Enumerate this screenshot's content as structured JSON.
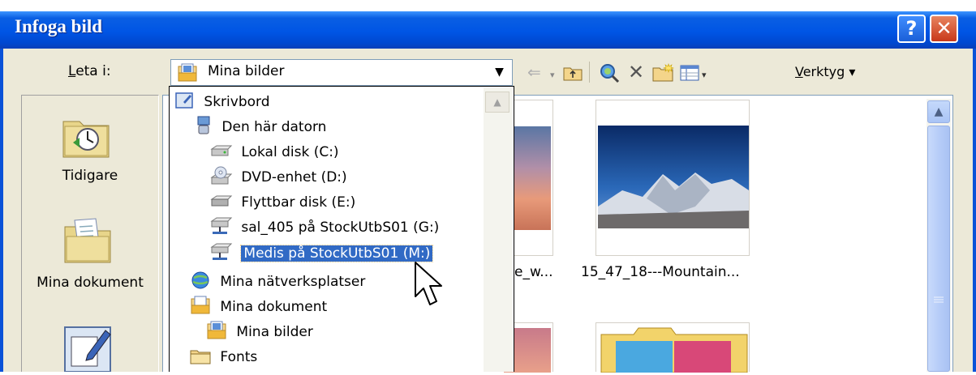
{
  "window": {
    "title": "Infoga bild",
    "help_glyph": "?",
    "close_glyph": "✕"
  },
  "lookin": {
    "label_underlined": "L",
    "label_rest": "eta i:",
    "value": "Mina bilder"
  },
  "toolbar": {
    "icons": [
      "back-arrow-icon",
      "up-folder-icon",
      "search-web-icon",
      "delete-icon",
      "new-folder-icon",
      "views-icon"
    ],
    "tools_underlined": "V",
    "tools_rest": "erktyg"
  },
  "places": [
    {
      "label": "Tidigare",
      "icon": "recent-icon"
    },
    {
      "label": "Mina dokument",
      "icon": "my-documents-icon"
    },
    {
      "label": "",
      "icon": "desktop-icon"
    }
  ],
  "files": {
    "label_left": "e_w...",
    "label_right": "15_47_18---Mountain..."
  },
  "dropdown": {
    "items": [
      {
        "label": "Skrivbord",
        "icon": "desktop-icon",
        "indent": 0
      },
      {
        "label": "Den här datorn",
        "icon": "computer-icon",
        "indent": 1
      },
      {
        "label": "Lokal disk (C:)",
        "icon": "hard-disk-icon",
        "indent": 2
      },
      {
        "label": "DVD-enhet (D:)",
        "icon": "dvd-drive-icon",
        "indent": 2
      },
      {
        "label": "Flyttbar disk (E:)",
        "icon": "removable-disk-icon",
        "indent": 2
      },
      {
        "label": "sal_405 på StockUtbS01 (G:)",
        "icon": "network-drive-icon",
        "indent": 2
      },
      {
        "label": "Medis på StockUtbS01 (M:)",
        "icon": "network-drive-icon",
        "indent": 2,
        "selected": true
      },
      {
        "label": "Mina nätverksplatser",
        "icon": "network-places-icon",
        "indent": 1
      },
      {
        "label": "Mina dokument",
        "icon": "my-documents-icon",
        "indent": 1
      },
      {
        "label": "Mina bilder",
        "icon": "my-pictures-icon",
        "indent": 2
      },
      {
        "label": "Fonts",
        "icon": "folder-icon",
        "indent": 1
      }
    ]
  },
  "colors": {
    "titlebar": "#0055e5",
    "face": "#ece9d8",
    "selection": "#316ac5"
  }
}
